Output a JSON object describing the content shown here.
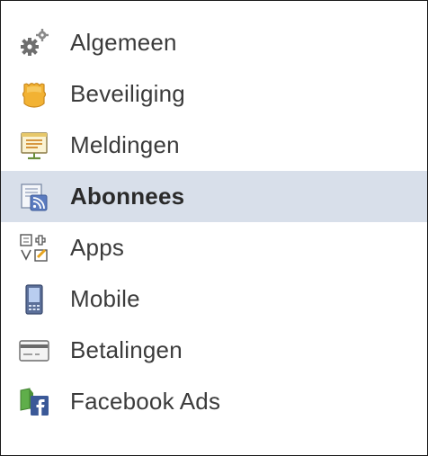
{
  "menu": {
    "active_index": 3,
    "items": [
      {
        "key": "algemeen",
        "label": "Algemeen",
        "icon": "gears-icon"
      },
      {
        "key": "beveiliging",
        "label": "Beveiliging",
        "icon": "badge-icon"
      },
      {
        "key": "meldingen",
        "label": "Meldingen",
        "icon": "notice-board-icon"
      },
      {
        "key": "abonnees",
        "label": "Abonnees",
        "icon": "subscriptions-icon"
      },
      {
        "key": "apps",
        "label": "Apps",
        "icon": "apps-icon"
      },
      {
        "key": "mobile",
        "label": "Mobile",
        "icon": "mobile-phone-icon"
      },
      {
        "key": "betalingen",
        "label": "Betalingen",
        "icon": "credit-card-icon"
      },
      {
        "key": "facebook-ads",
        "label": "Facebook Ads",
        "icon": "facebook-ads-icon"
      }
    ]
  },
  "colors": {
    "active_background": "#d8dfea",
    "text": "#3b3b3b",
    "facebook_blue": "#3b5998"
  }
}
